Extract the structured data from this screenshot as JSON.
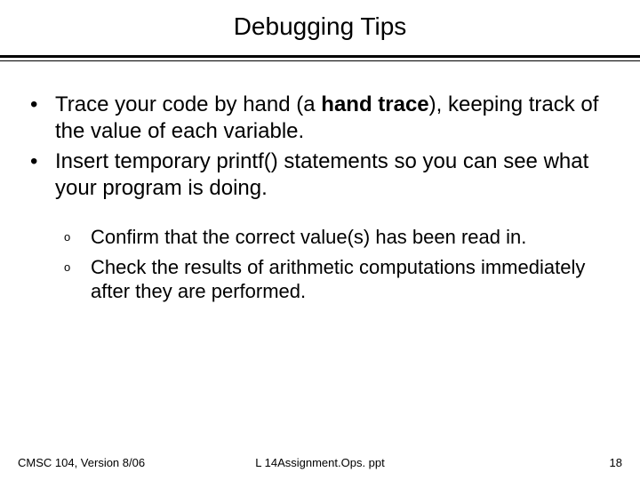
{
  "title": "Debugging Tips",
  "bullets": {
    "marker": "•",
    "item1_pre": "Trace your code by hand (a ",
    "item1_bold": "hand trace",
    "item1_post": "), keeping track of the value of each variable.",
    "item2": "Insert temporary printf() statements so you can see what your program is doing."
  },
  "sub": {
    "marker": "o",
    "item1": "Confirm that the correct value(s) has been read in.",
    "item2": "Check the results of arithmetic computations immediately after they are performed."
  },
  "footer": {
    "left": "CMSC 104, Version 8/06",
    "center": "L 14Assignment.Ops. ppt",
    "right": "18"
  }
}
